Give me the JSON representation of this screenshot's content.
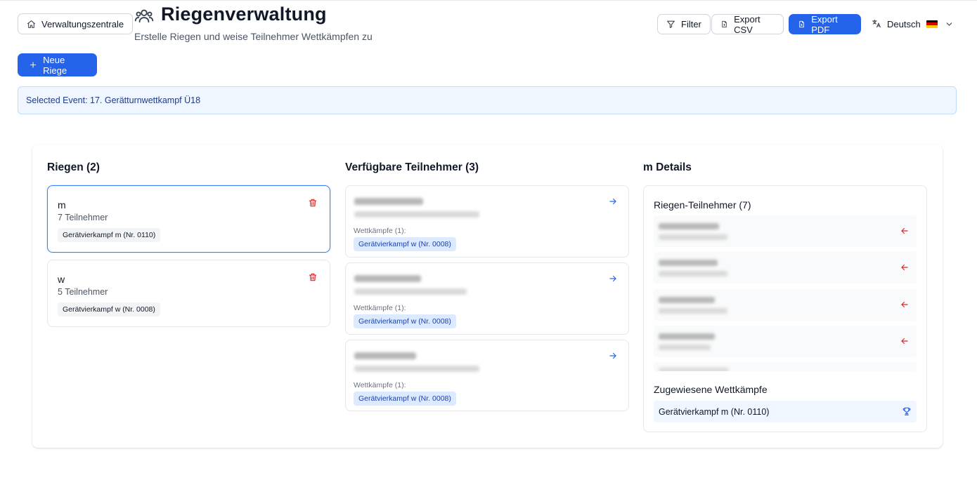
{
  "header": {
    "home_button": "Verwaltungszentrale",
    "title": "Riegenverwaltung",
    "subtitle": "Erstelle Riegen und weise Teilnehmer Wettkämpfen zu",
    "filter_label": "Filter",
    "export_csv_label": "Export CSV",
    "export_pdf_label": "Export PDF",
    "language": "Deutsch",
    "new_riege_label": "Neue Riege"
  },
  "event_banner": "Selected Event: 17. Gerätturnwettkampf Ü18",
  "riegen": {
    "title": "Riegen (2)",
    "items": [
      {
        "name": "m",
        "count": "7 Teilnehmer",
        "competition": "Gerätvierkampf m (Nr. 0110)",
        "selected": true
      },
      {
        "name": "w",
        "count": "5 Teilnehmer",
        "competition": "Gerätvierkampf w (Nr. 0008)",
        "selected": false
      }
    ]
  },
  "available": {
    "title": "Verfügbare Teilnehmer (3)",
    "items": [
      {
        "wk_label": "Wettkämpfe (1):",
        "competition": "Gerätvierkampf w (Nr. 0008)"
      },
      {
        "wk_label": "Wettkämpfe (1):",
        "competition": "Gerätvierkampf w (Nr. 0008)"
      },
      {
        "wk_label": "Wettkämpfe (1):",
        "competition": "Gerätvierkampf w (Nr. 0008)"
      }
    ]
  },
  "details": {
    "title": "m Details",
    "members_title": "Riegen-Teilnehmer (7)",
    "assigned_title": "Zugewiesene Wettkämpfe",
    "assigned_competition": "Gerätvierkampf m (Nr. 0110)"
  },
  "colors": {
    "primary": "#2563eb",
    "danger": "#dc2626",
    "banner_bg": "#eff6ff",
    "chip_blue": "#dbeafe"
  },
  "icons": [
    "home-icon",
    "users-icon",
    "filter-icon",
    "file-icon",
    "translate-icon",
    "chevron-down-icon",
    "plus-icon",
    "trash-icon",
    "arrow-right-icon",
    "arrow-left-icon",
    "trophy-icon"
  ]
}
